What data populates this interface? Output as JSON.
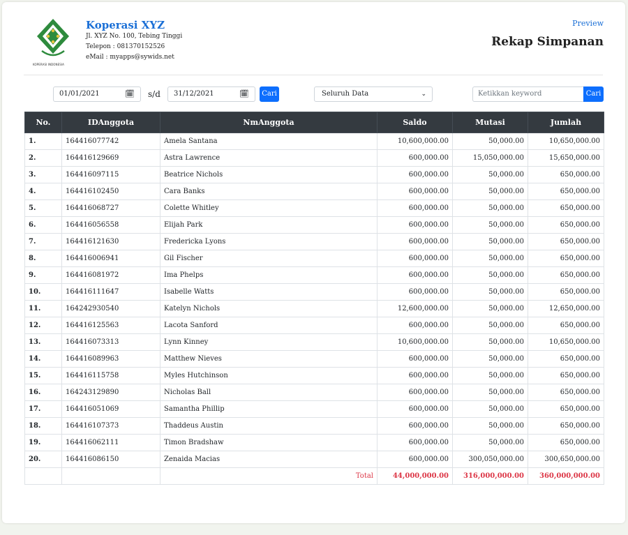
{
  "org": {
    "name": "Koperasi XYZ",
    "address": "Jl. XYZ No. 100, Tebing Tinggi",
    "phone": "Telepon : 081370152526",
    "email": "eMail : myapps@sywids.net",
    "logo_caption": "KOPERASI INDONESIA",
    "logo_color": "#2e8b3d"
  },
  "header": {
    "preview_link": "Preview",
    "title": "Rekap Simpanan"
  },
  "filters": {
    "date_from": "01/01/2021",
    "separator": "s/d",
    "date_to": "31/12/2021",
    "filter_button": "Cari",
    "select_value": "Seluruh Data",
    "search_placeholder": "Ketikkan keyword",
    "search_button": "Cari",
    "accent_color": "#0d6efd"
  },
  "table": {
    "columns": [
      "No.",
      "IDAnggota",
      "NmAnggota",
      "Saldo",
      "Mutasi",
      "Jumlah"
    ],
    "rows": [
      {
        "no": "1.",
        "id": "164416077742",
        "name": "Amela Santana",
        "saldo": "10,600,000.00",
        "mutasi": "50,000.00",
        "jumlah": "10,650,000.00"
      },
      {
        "no": "2.",
        "id": "164416129669",
        "name": "Astra Lawrence",
        "saldo": "600,000.00",
        "mutasi": "15,050,000.00",
        "jumlah": "15,650,000.00"
      },
      {
        "no": "3.",
        "id": "164416097115",
        "name": "Beatrice Nichols",
        "saldo": "600,000.00",
        "mutasi": "50,000.00",
        "jumlah": "650,000.00"
      },
      {
        "no": "4.",
        "id": "164416102450",
        "name": "Cara Banks",
        "saldo": "600,000.00",
        "mutasi": "50,000.00",
        "jumlah": "650,000.00"
      },
      {
        "no": "5.",
        "id": "164416068727",
        "name": "Colette Whitley",
        "saldo": "600,000.00",
        "mutasi": "50,000.00",
        "jumlah": "650,000.00"
      },
      {
        "no": "6.",
        "id": "164416056558",
        "name": "Elijah Park",
        "saldo": "600,000.00",
        "mutasi": "50,000.00",
        "jumlah": "650,000.00"
      },
      {
        "no": "7.",
        "id": "164416121630",
        "name": "Fredericka Lyons",
        "saldo": "600,000.00",
        "mutasi": "50,000.00",
        "jumlah": "650,000.00"
      },
      {
        "no": "8.",
        "id": "164416006941",
        "name": "Gil Fischer",
        "saldo": "600,000.00",
        "mutasi": "50,000.00",
        "jumlah": "650,000.00"
      },
      {
        "no": "9.",
        "id": "164416081972",
        "name": "Ima Phelps",
        "saldo": "600,000.00",
        "mutasi": "50,000.00",
        "jumlah": "650,000.00"
      },
      {
        "no": "10.",
        "id": "164416111647",
        "name": "Isabelle Watts",
        "saldo": "600,000.00",
        "mutasi": "50,000.00",
        "jumlah": "650,000.00"
      },
      {
        "no": "11.",
        "id": "164242930540",
        "name": "Katelyn Nichols",
        "saldo": "12,600,000.00",
        "mutasi": "50,000.00",
        "jumlah": "12,650,000.00"
      },
      {
        "no": "12.",
        "id": "164416125563",
        "name": "Lacota Sanford",
        "saldo": "600,000.00",
        "mutasi": "50,000.00",
        "jumlah": "650,000.00"
      },
      {
        "no": "13.",
        "id": "164416073313",
        "name": "Lynn Kinney",
        "saldo": "10,600,000.00",
        "mutasi": "50,000.00",
        "jumlah": "10,650,000.00"
      },
      {
        "no": "14.",
        "id": "164416089963",
        "name": "Matthew Nieves",
        "saldo": "600,000.00",
        "mutasi": "50,000.00",
        "jumlah": "650,000.00"
      },
      {
        "no": "15.",
        "id": "164416115758",
        "name": "Myles Hutchinson",
        "saldo": "600,000.00",
        "mutasi": "50,000.00",
        "jumlah": "650,000.00"
      },
      {
        "no": "16.",
        "id": "164243129890",
        "name": "Nicholas Ball",
        "saldo": "600,000.00",
        "mutasi": "50,000.00",
        "jumlah": "650,000.00"
      },
      {
        "no": "17.",
        "id": "164416051069",
        "name": "Samantha Phillip",
        "saldo": "600,000.00",
        "mutasi": "50,000.00",
        "jumlah": "650,000.00"
      },
      {
        "no": "18.",
        "id": "164416107373",
        "name": "Thaddeus Austin",
        "saldo": "600,000.00",
        "mutasi": "50,000.00",
        "jumlah": "650,000.00"
      },
      {
        "no": "19.",
        "id": "164416062111",
        "name": "Timon Bradshaw",
        "saldo": "600,000.00",
        "mutasi": "50,000.00",
        "jumlah": "650,000.00"
      },
      {
        "no": "20.",
        "id": "164416086150",
        "name": "Zenaida Macias",
        "saldo": "600,000.00",
        "mutasi": "300,050,000.00",
        "jumlah": "300,650,000.00"
      }
    ],
    "total": {
      "label": "Total",
      "saldo": "44,000,000.00",
      "mutasi": "316,000,000.00",
      "jumlah": "360,000,000.00"
    },
    "header_bg": "#343a40",
    "total_color": "#dc3545"
  }
}
